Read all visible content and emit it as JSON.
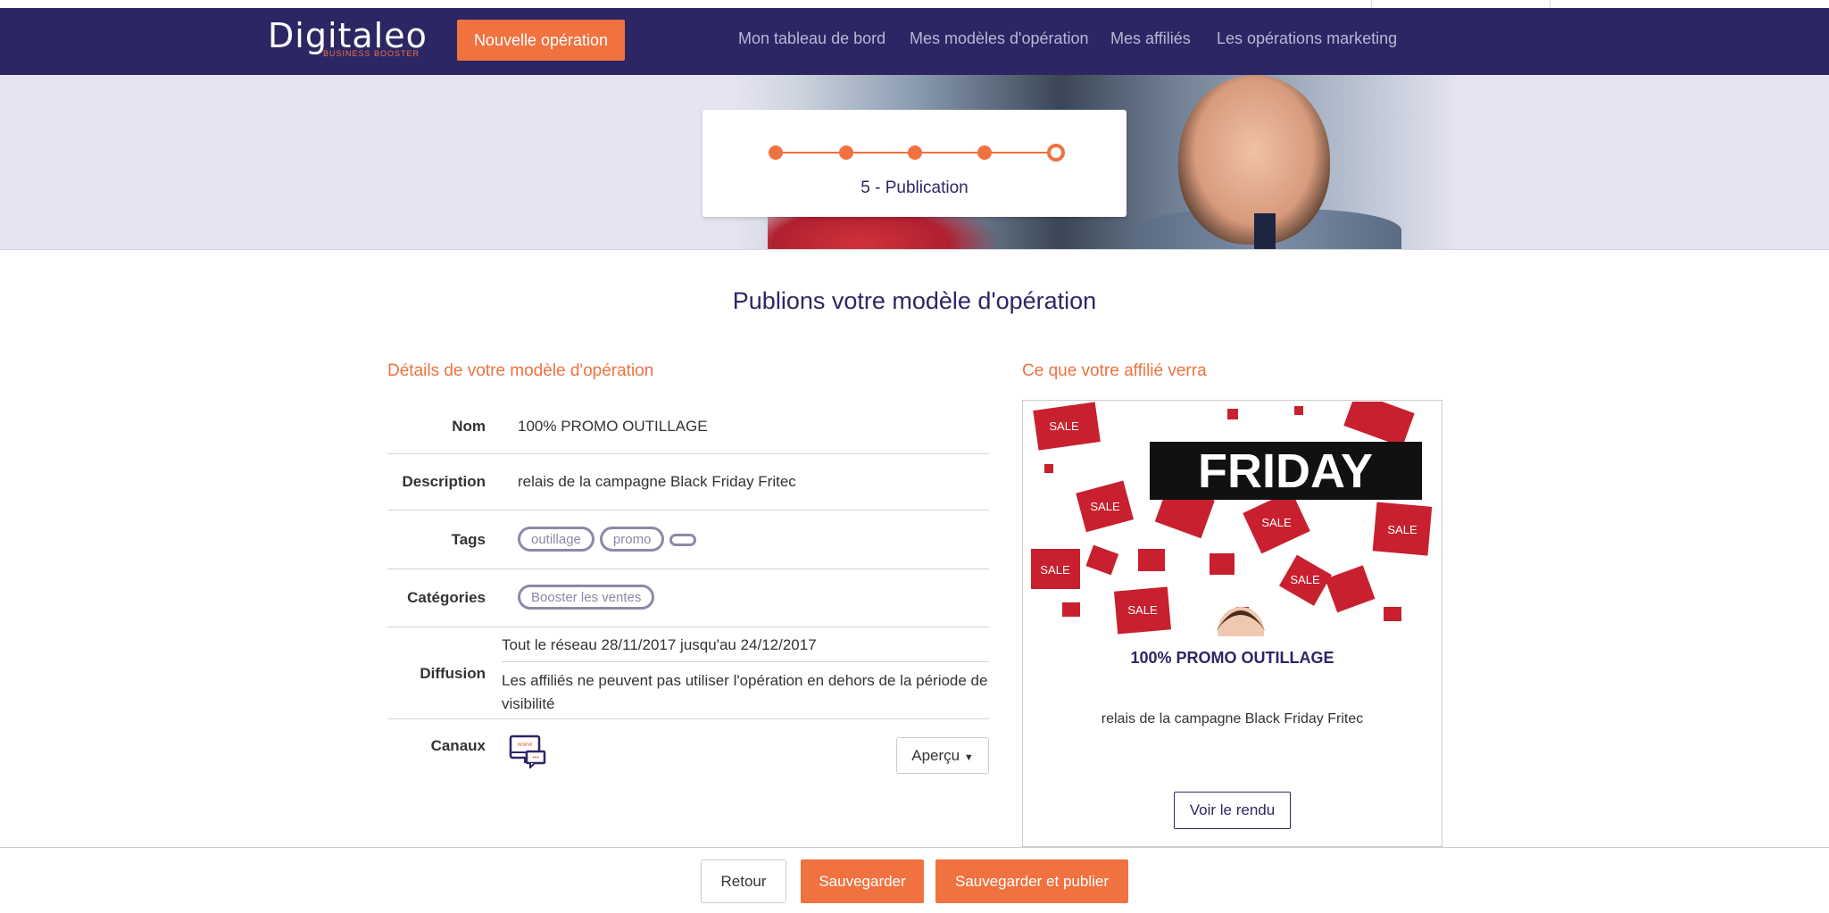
{
  "brand": {
    "logo": "Digitaleo",
    "tagline": "BUSINESS BOOSTER",
    "accent": "#f07240",
    "navy": "#2d2664"
  },
  "nav": {
    "new_operation": "Nouvelle opération",
    "links": [
      "Mon tableau de bord",
      "Mes modèles d'opération",
      "Mes affiliés",
      "Les opérations marketing"
    ]
  },
  "stepper": {
    "current_step": 5,
    "total_steps": 5,
    "label": "5 - Publication"
  },
  "page_title": "Publions votre modèle d'opération",
  "details": {
    "heading": "Détails de votre modèle d'opération",
    "nom_label": "Nom",
    "nom": "100% PROMO OUTILLAGE",
    "description_label": "Description",
    "description": "relais de la campagne Black Friday Fritec",
    "tags_label": "Tags",
    "tags": [
      "outillage",
      "promo",
      ""
    ],
    "categories_label": "Catégories",
    "categories": [
      "Booster les ventes"
    ],
    "diffusion_label": "Diffusion",
    "diffusion_period": "Tout le réseau 28/11/2017 jusqu'au 24/12/2017",
    "diffusion_rule": "Les affiliés ne peuvent pas utiliser l'opération en dehors de la période de visibilité",
    "canaux_label": "Canaux",
    "canaux_icon": "web-chat-icon",
    "apercu_label": "Aperçu"
  },
  "preview": {
    "heading": "Ce que votre affilié verra",
    "image_text": "FRIDAY",
    "sale": "SALE",
    "title": "100% PROMO OUTILLAGE",
    "description": "relais de la campagne Black Friday Fritec",
    "render_button": "Voir le rendu"
  },
  "footer": {
    "back": "Retour",
    "save": "Sauvegarder",
    "save_publish": "Sauvegarder et publier"
  }
}
